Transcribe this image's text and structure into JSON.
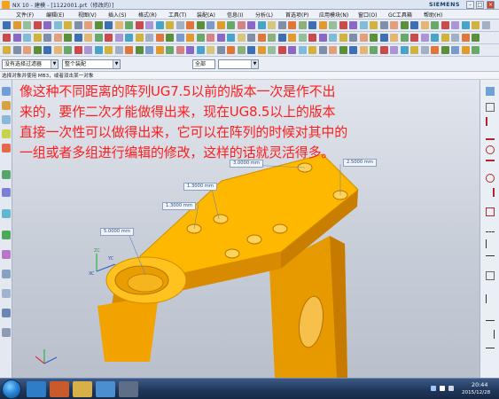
{
  "window": {
    "title": "NX 10 - 建模 - [1122001.prt（修改的）]",
    "brand": "SIEMENS",
    "controls": [
      "min",
      "max",
      "close"
    ]
  },
  "menu": [
    "文件(F)",
    "编辑(E)",
    "视图(V)",
    "插入(S)",
    "格式(R)",
    "工具(T)",
    "装配(A)",
    "信息(I)",
    "分析(L)",
    "首选项(P)",
    "应用模块(N)",
    "窗口(O)",
    "GC工具箱",
    "帮助(H)"
  ],
  "selection_bar": {
    "filter_value": "没有选择过滤器",
    "scope_value": "整个装配",
    "snap_value": "全部"
  },
  "cue_line": "选择对象并使用 MB3，或者双击某一对象",
  "annotation": "像这种不同距离的阵列UG7.5以前的版本一次是作不出来的，要作二次才能做得出来，现在UG8.5以上的版本直接一次性可以做得出来，它可以在阵列的时候对其中的一组或者多组进行编辑的修改，这样的话就灵活得多。",
  "dimensions": [
    "3.0000 mm",
    "2.5000 mm",
    "1.3000 mm",
    "1.3000 mm",
    "5.0000 mm"
  ],
  "triad": {
    "x": "XC",
    "y": "YC",
    "z": "ZC"
  },
  "taskbar": {
    "time": "20:44",
    "date": "2015/12/28",
    "icons": [
      "start",
      "app-blue",
      "app-orange",
      "folder",
      "explorer",
      "nx"
    ]
  },
  "colors": {
    "model_face_top": "#ffb800",
    "model_face_side": "#e69400",
    "annotation_red": "#ff1e1e",
    "background_top": "#e2e6ee",
    "background_bottom": "#b9c0cc"
  }
}
